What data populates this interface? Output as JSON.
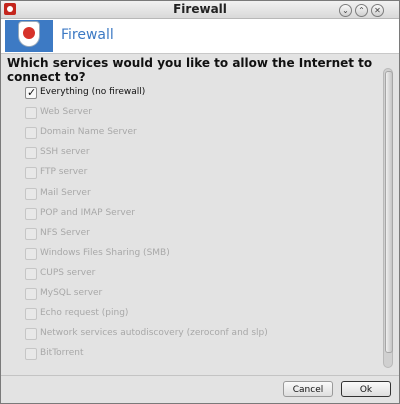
{
  "window": {
    "title": "Firewall"
  },
  "titlebar_buttons": [
    {
      "icon": "minimize-icon",
      "glyph": "⌄"
    },
    {
      "icon": "maximize-icon",
      "glyph": "⌃"
    },
    {
      "icon": "close-icon",
      "glyph": "✕"
    }
  ],
  "header": {
    "title": "Firewall"
  },
  "question": "Which services would you like to allow the Internet to connect to?",
  "services": [
    {
      "label": "Everything (no firewall)",
      "checked": true,
      "enabled": true
    },
    {
      "label": "Web Server",
      "checked": false,
      "enabled": false
    },
    {
      "label": "Domain Name Server",
      "checked": false,
      "enabled": false
    },
    {
      "label": "SSH server",
      "checked": false,
      "enabled": false
    },
    {
      "label": "FTP server",
      "checked": false,
      "enabled": false
    },
    {
      "label": "Mail Server",
      "checked": false,
      "enabled": false
    },
    {
      "label": "POP and IMAP Server",
      "checked": false,
      "enabled": false
    },
    {
      "label": "NFS Server",
      "checked": false,
      "enabled": false
    },
    {
      "label": "Windows Files Sharing (SMB)",
      "checked": false,
      "enabled": false
    },
    {
      "label": "CUPS server",
      "checked": false,
      "enabled": false
    },
    {
      "label": "MySQL server",
      "checked": false,
      "enabled": false
    },
    {
      "label": "Echo request (ping)",
      "checked": false,
      "enabled": false
    },
    {
      "label": "Network services autodiscovery (zeroconf and slp)",
      "checked": false,
      "enabled": false
    },
    {
      "label": "BitTorrent",
      "checked": false,
      "enabled": false
    }
  ],
  "buttons": {
    "cancel": "Cancel",
    "ok": "Ok"
  },
  "colors": {
    "accent": "#3d7ac4",
    "disabled_text": "#a8a8a8"
  }
}
